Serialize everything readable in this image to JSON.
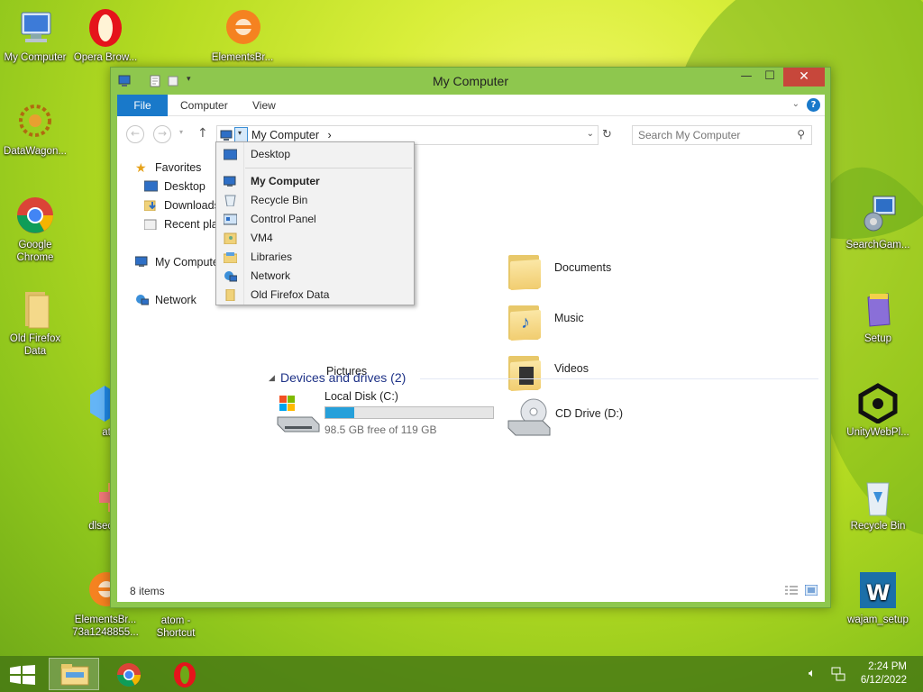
{
  "colors": {
    "accent": "#1979ca",
    "window_frame": "#8ec74e",
    "close": "#c7473b",
    "heading": "#1e3287",
    "disk_bar": "#26a0da"
  },
  "desktop": {
    "left_icons": [
      {
        "name": "my-computer-desktop-icon",
        "label": "My Computer",
        "icon": "computer-icon"
      },
      {
        "name": "opera-desktop-icon",
        "label": "Opera Brow...",
        "icon": "opera-icon"
      },
      {
        "name": "elementsbr-desktop-icon",
        "label": "ElementsBr...",
        "icon": "elements-icon"
      },
      {
        "name": "datawagon-desktop-icon",
        "label": "DataWagon...",
        "icon": "datawagon-icon"
      },
      {
        "name": "chrome-desktop-icon",
        "label": "Google Chrome",
        "icon": "chrome-icon"
      },
      {
        "name": "old-firefox-data-desktop-icon",
        "label": "Old Firefox Data",
        "icon": "folder-icon"
      },
      {
        "name": "atom-desktop-icon",
        "label": "atom",
        "icon": "atom-icon"
      },
      {
        "name": "dlsecure-desktop-icon",
        "label": "dlsecure",
        "icon": "dlsecure-icon"
      },
      {
        "name": "elementsbr2-desktop-icon",
        "label": "ElementsBr... 73a1248855...",
        "icon": "elements-icon"
      },
      {
        "name": "atom-shortcut-desktop-icon",
        "label": "atom - Shortcut",
        "icon": "atom-icon"
      }
    ],
    "right_icons": [
      {
        "label": "SearchGam..."
      },
      {
        "label": "Setup"
      },
      {
        "label": "UnityWebPl..."
      },
      {
        "label": "Recycle Bin"
      },
      {
        "label": "wajam_setup"
      }
    ]
  },
  "window": {
    "title": "My Computer",
    "minimize": "—",
    "maximize": "☐",
    "close": "✕",
    "tabs": [
      "File",
      "Computer",
      "View"
    ]
  },
  "address": {
    "path": "My Computer",
    "separator": "›"
  },
  "search": {
    "placeholder": "Search My Computer"
  },
  "navpane": {
    "favorites": "Favorites",
    "desktop": "Desktop",
    "downloads": "Downloads",
    "recent": "Recent places",
    "my_computer": "My Computer",
    "network": "Network"
  },
  "folders": {
    "documents": "Documents",
    "music": "Music",
    "videos": "Videos",
    "pictures": "Pictures"
  },
  "devices": {
    "heading": "Devices and drives (2)",
    "local_disk": {
      "name": "Local Disk (C:)",
      "free": "98.5 GB free of 119 GB",
      "used_fraction": 0.17
    },
    "cd_drive": {
      "name": "CD Drive (D:)"
    }
  },
  "status": {
    "items": "8 items"
  },
  "menu": {
    "items": [
      "Desktop",
      "My Computer",
      "Recycle Bin",
      "Control Panel",
      "VM4",
      "Libraries",
      "Network",
      "Old Firefox Data"
    ]
  },
  "tray": {
    "time": "2:24 PM",
    "date": "6/12/2022"
  }
}
